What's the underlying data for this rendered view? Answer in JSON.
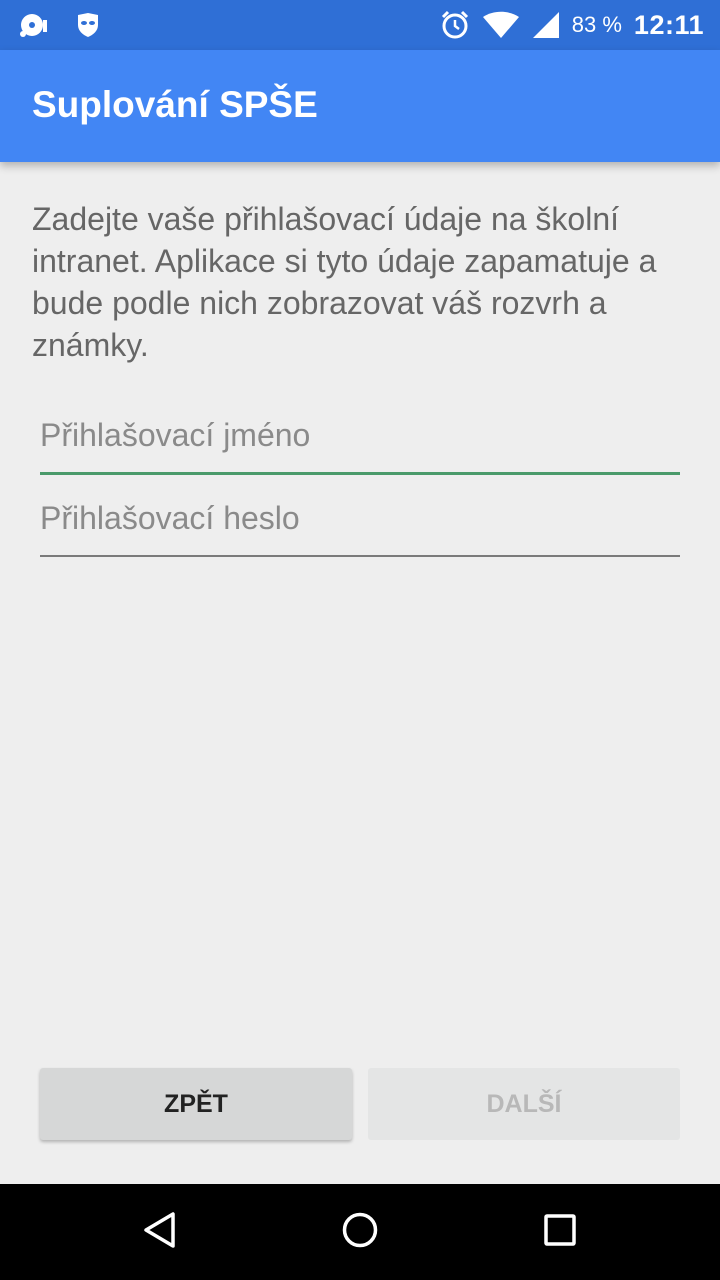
{
  "status_bar": {
    "battery_percent": "83 %",
    "time": "12:11"
  },
  "app_bar": {
    "title": "Suplování SPŠE"
  },
  "form": {
    "instructions": "Zadejte vaše přihlašovací údaje na školní intranet. Aplikace si tyto údaje zapamatuje a bude podle nich zobrazovat váš rozvrh a známky.",
    "username_placeholder": "Přihlašovací jméno",
    "password_placeholder": "Přihlašovací heslo"
  },
  "buttons": {
    "back_label": "ZPĚT",
    "next_label": "DALŠÍ"
  },
  "colors": {
    "status_bar": "#2f6fd6",
    "app_bar": "#4286f4",
    "background": "#eeeeee",
    "active_underline": "#4a9a6a"
  },
  "icons": {
    "status_left": [
      "disc-notification-icon",
      "mask-notification-icon"
    ],
    "status_right": [
      "alarm-icon",
      "wifi-icon",
      "signal-icon"
    ],
    "nav": [
      "back-triangle-icon",
      "home-circle-icon",
      "recent-square-icon"
    ]
  }
}
